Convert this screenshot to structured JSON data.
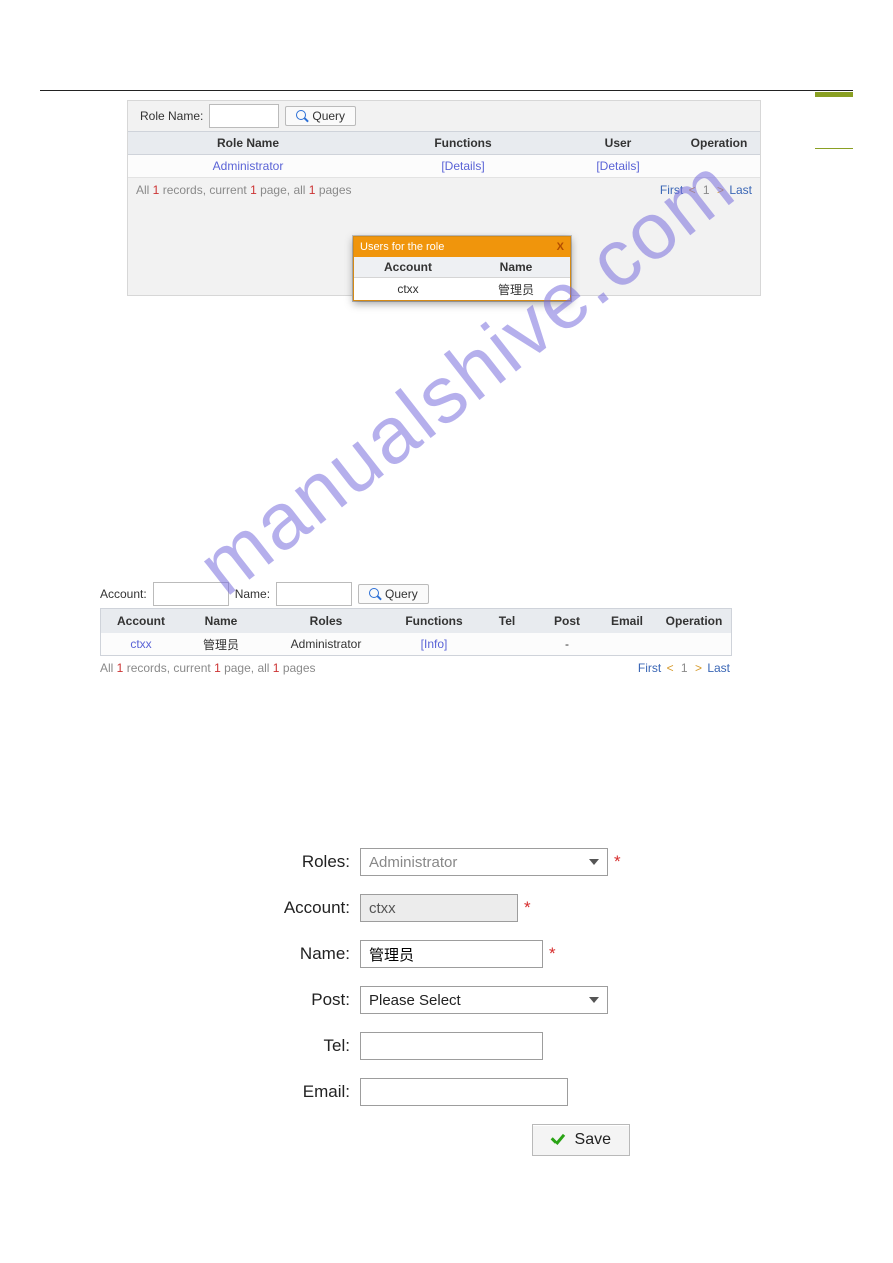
{
  "watermark": "manualshive.com",
  "panel1": {
    "search_label": "Role Name:",
    "query_label": "Query",
    "headers": {
      "rolename": "Role Name",
      "functions": "Functions",
      "user": "User",
      "operation": "Operation"
    },
    "row": {
      "rolename": "Administrator",
      "functions": "[Details]",
      "user": "[Details]"
    },
    "footer_a": "All ",
    "footer_b": " records, current ",
    "footer_c": " page, all ",
    "footer_d": " pages",
    "footer_n1": "1",
    "footer_n2": "1",
    "footer_n3": "1",
    "pager": {
      "first": "First",
      "page": "1",
      "last": "Last"
    },
    "popup": {
      "title": "Users for the role",
      "close": "X",
      "h_account": "Account",
      "h_name": "Name",
      "r_account": "ctxx",
      "r_name": "管理员"
    }
  },
  "panel2": {
    "acct_label": "Account:",
    "name_label": "Name:",
    "query_label": "Query",
    "headers": {
      "account": "Account",
      "name": "Name",
      "roles": "Roles",
      "functions": "Functions",
      "tel": "Tel",
      "post": "Post",
      "email": "Email",
      "operation": "Operation"
    },
    "row": {
      "account": "ctxx",
      "name": "管理员",
      "roles": "Administrator",
      "functions": "[Info]",
      "tel": "",
      "post": "-",
      "email": ""
    },
    "footer_a": "All ",
    "footer_b": " records, current ",
    "footer_c": " page, all ",
    "footer_d": " pages",
    "footer_n1": "1",
    "footer_n2": "1",
    "footer_n3": "1",
    "pager": {
      "first": "First",
      "page": "1",
      "last": "Last"
    }
  },
  "form3": {
    "roles": {
      "label": "Roles:",
      "value": "Administrator"
    },
    "account": {
      "label": "Account:",
      "value": "ctxx"
    },
    "name": {
      "label": "Name:",
      "value": "管理员"
    },
    "post": {
      "label": "Post:",
      "value": "Please Select"
    },
    "tel": {
      "label": "Tel:",
      "value": ""
    },
    "email": {
      "label": "Email:",
      "value": ""
    },
    "save": "Save",
    "star": "*"
  }
}
